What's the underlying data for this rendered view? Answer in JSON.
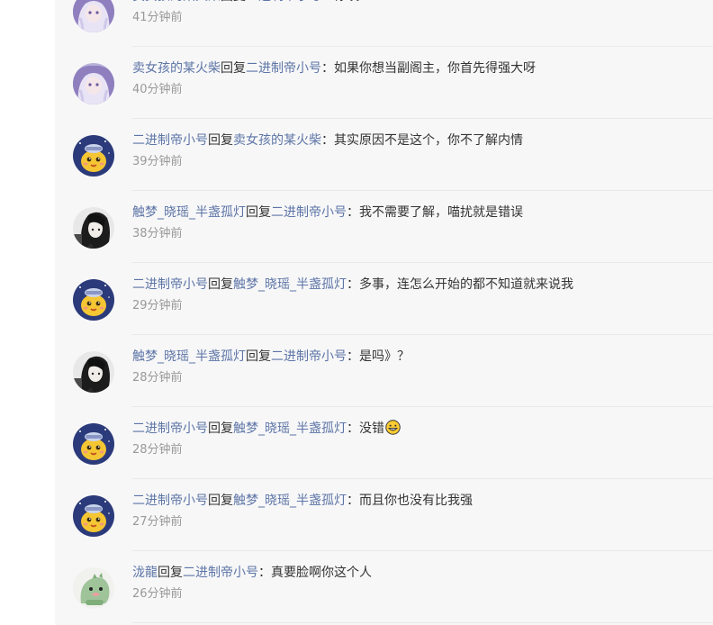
{
  "colors": {
    "username": "#5d75a6",
    "text": "#333333",
    "time": "#999999",
    "panel_bg": "#f7f7f8"
  },
  "replies": [
    {
      "avatar": "girl-anime-avatar-icon",
      "from": "卖女孩的某火柴",
      "verb": "回复",
      "to": "二进制帝小号",
      "sep": "：",
      "content": "你哎",
      "time": "41分钟前"
    },
    {
      "avatar": "girl-anime-avatar-icon",
      "from": "卖女孩的某火柴",
      "verb": "回复",
      "to": "二进制帝小号",
      "sep": "：",
      "content": "如果你想当副阁主，你首先得强大呀",
      "time": "40分钟前"
    },
    {
      "avatar": "yellow-chick-avatar-icon",
      "from": "二进制帝小号",
      "verb": "回复",
      "to": "卖女孩的某火柴",
      "sep": "：",
      "content": "其实原因不是这个，你不了解内情",
      "time": "39分钟前"
    },
    {
      "avatar": "dark-haired-avatar-icon",
      "from": "触梦_晓瑶_半盏孤灯",
      "verb": "回复",
      "to": "二进制帝小号",
      "sep": "：",
      "content": "我不需要了解，喵扰就是错误",
      "time": "38分钟前"
    },
    {
      "avatar": "yellow-chick-avatar-icon",
      "from": "二进制帝小号",
      "verb": "回复",
      "to": "触梦_晓瑶_半盏孤灯",
      "sep": "：",
      "content": "多事，连怎么开始的都不知道就来说我",
      "time": "29分钟前"
    },
    {
      "avatar": "dark-haired-avatar-icon",
      "from": "触梦_晓瑶_半盏孤灯",
      "verb": "回复",
      "to": "二进制帝小号",
      "sep": "：",
      "content": "是吗》？",
      "time": "28分钟前"
    },
    {
      "avatar": "yellow-chick-avatar-icon",
      "from": "二进制帝小号",
      "verb": "回复",
      "to": "触梦_晓瑶_半盏孤灯",
      "sep": "：",
      "content": "没错",
      "emoji": "grinning-face-emoji",
      "time": "28分钟前"
    },
    {
      "avatar": "yellow-chick-avatar-icon",
      "from": "二进制帝小号",
      "verb": "回复",
      "to": "触梦_晓瑶_半盏孤灯",
      "sep": "：",
      "content": "而且你也没有比我强",
      "time": "27分钟前"
    },
    {
      "avatar": "green-dino-avatar-icon",
      "from": "泷龍",
      "verb": "回复",
      "to": "二进制帝小号",
      "sep": "：",
      "content": "真要脸啊你这个人",
      "time": "26分钟前"
    }
  ]
}
